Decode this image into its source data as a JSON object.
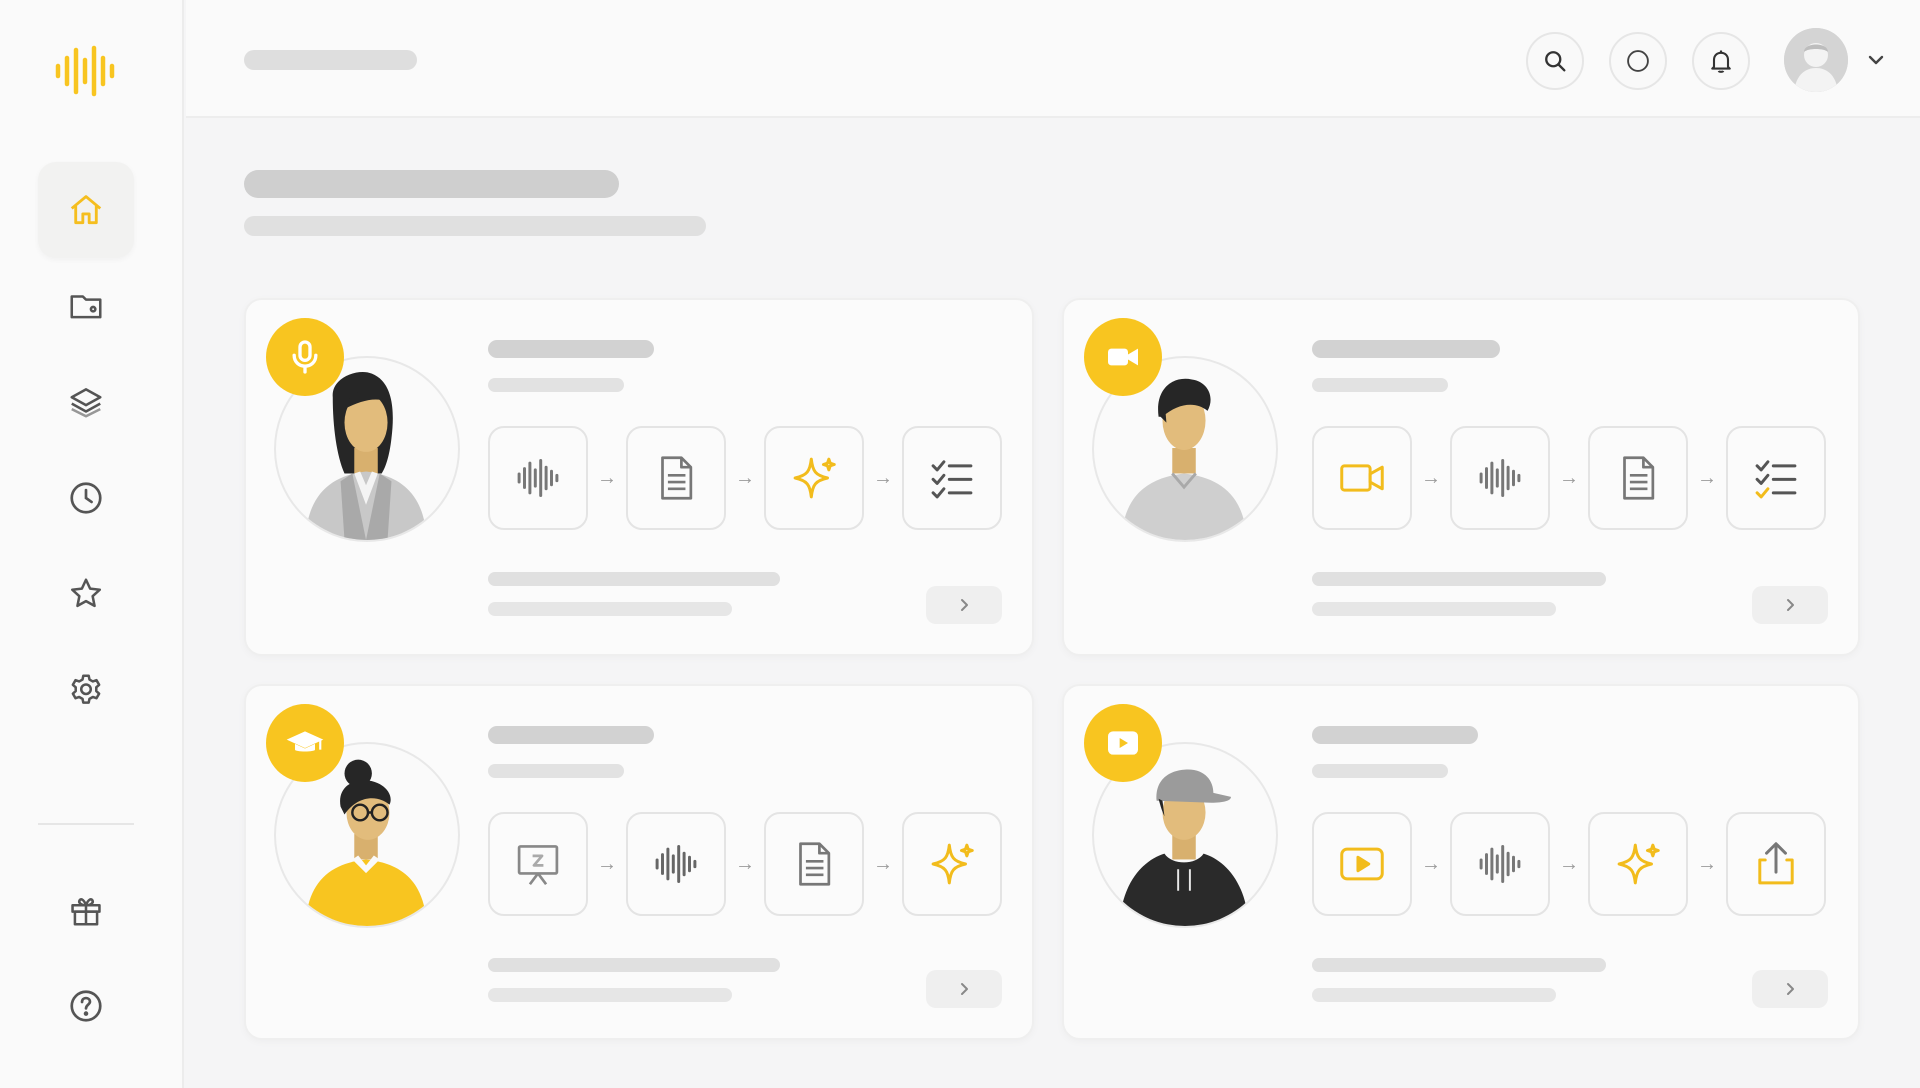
{
  "app": {
    "logo_icon": "waveform-logo-icon",
    "accent_color": "#f8c520"
  },
  "sidebar": {
    "items": [
      {
        "name": "home",
        "icon": "home-icon",
        "active": true
      },
      {
        "name": "folder",
        "icon": "folder-icon",
        "active": false
      },
      {
        "name": "layers",
        "icon": "layers-icon",
        "active": false
      },
      {
        "name": "history",
        "icon": "clock-icon",
        "active": false
      },
      {
        "name": "favorites",
        "icon": "star-icon",
        "active": false
      },
      {
        "name": "settings",
        "icon": "gear-icon",
        "active": false
      }
    ],
    "bottom_items": [
      {
        "name": "gift",
        "icon": "gift-icon"
      },
      {
        "name": "help",
        "icon": "help-icon"
      }
    ]
  },
  "header": {
    "actions": [
      "search-icon",
      "circle-icon",
      "bell-icon"
    ],
    "user_menu": "avatar"
  },
  "cards": [
    {
      "badge_icon": "microphone-icon",
      "persona": "woman-professional",
      "workflow": [
        "waveform-icon",
        "document-icon",
        "sparkle-icon",
        "checklist-icon"
      ]
    },
    {
      "badge_icon": "video-camera-icon",
      "persona": "man-casual",
      "workflow": [
        "video-camera-icon",
        "waveform-icon",
        "document-icon",
        "checklist-icon"
      ]
    },
    {
      "badge_icon": "graduation-cap-icon",
      "persona": "woman-student",
      "workflow": [
        "presentation-icon",
        "waveform-icon",
        "document-icon",
        "sparkle-icon"
      ]
    },
    {
      "badge_icon": "play-icon",
      "persona": "man-creator",
      "workflow": [
        "play-icon",
        "waveform-icon",
        "sparkle-icon",
        "upload-icon"
      ]
    }
  ]
}
